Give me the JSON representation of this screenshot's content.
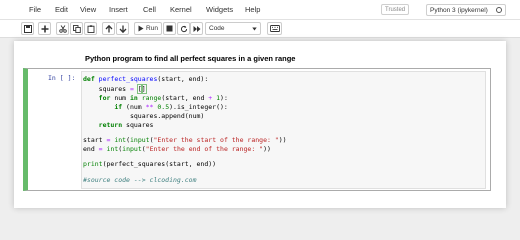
{
  "menu": {
    "items": [
      "File",
      "Edit",
      "View",
      "Insert",
      "Cell",
      "Kernel",
      "Widgets",
      "Help"
    ],
    "trusted": "Trusted",
    "kernel_name": "Python 3 (ipykernel)"
  },
  "toolbar": {
    "run_label": "Run",
    "cell_type": "Code"
  },
  "notebook": {
    "title": "Python program to find all perfect squares in a given range",
    "cell": {
      "prompt": "In [ ]:",
      "code_lines": [
        "def perfect_squares(start, end):",
        "    squares = []",
        "    for num in range(start, end + 1):",
        "        if (num ** 0.5).is_integer():",
        "            squares.append(num)",
        "    return squares",
        "",
        "start = int(input(\"Enter the start of the range: \"))",
        "end = int(input(\"Enter the end of the range: \"))",
        "",
        "print(perfect_squares(start, end))",
        "",
        "#source code --> clcoding.com"
      ]
    }
  },
  "colors": {
    "cell_border_active": "#66bb6a",
    "prompt": "#303f9f",
    "keyword": "#008000",
    "function_name": "#0000ff",
    "string": "#ba2121",
    "comment": "#408080"
  }
}
